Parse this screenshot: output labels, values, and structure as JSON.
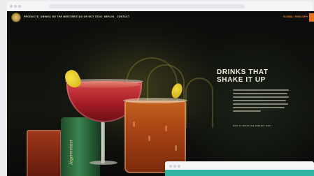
{
  "site": {
    "nav": {
      "logo_icon": "stag-head-logo-icon",
      "items": [
        "PRODUCTS",
        "DRINKS",
        "BE THE MEISTER",
        "STAG OR NOT STAG",
        "BERLIN",
        "CONTACT"
      ]
    },
    "region_selector": "GLOBAL / ENGLISH ▾",
    "hero": {
      "headline_line1": "DRINKS THAT",
      "headline_line2": "SHAKE IT UP",
      "link": "HOW TO SERVE THE PERFECT SHOT"
    },
    "bottle_label": "Jägermeister"
  },
  "colors": {
    "accent": "#e5761f",
    "background": "#0b0c0a",
    "teal": "#2fb3a3"
  }
}
